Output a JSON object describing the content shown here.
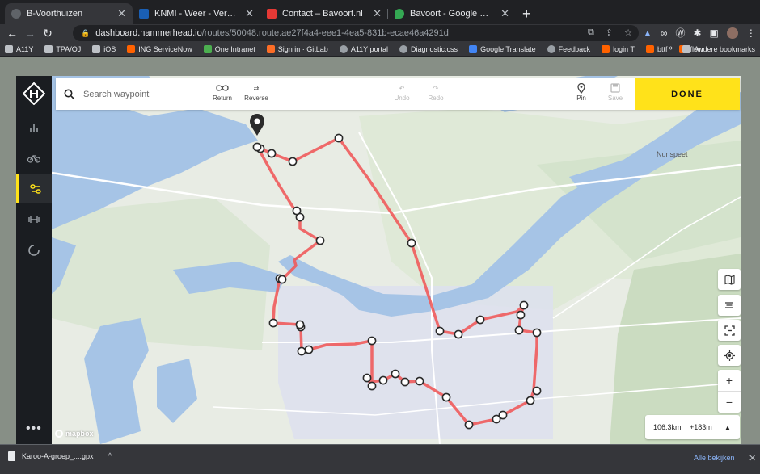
{
  "browser": {
    "tabs": [
      {
        "title": "B-Voorthuizen",
        "active": true,
        "favicon_color": "#5f6368"
      },
      {
        "title": "KNMI - Weer - Verwachtingen",
        "active": false,
        "favicon_color": "#1a5fb4"
      },
      {
        "title": "Contact – Bavoort.nl",
        "active": false,
        "favicon_color": "#e53935"
      },
      {
        "title": "Bavoort - Google Maps",
        "active": false,
        "favicon_color": "#34a853"
      }
    ],
    "url_host": "dashboard.hammerhead.io",
    "url_path": "/routes/50048.route.ae27f4a4-eee1-4ea5-831b-ecae46a4291d",
    "bookmarks": [
      {
        "label": "A11Y",
        "icon": "folder-icon",
        "color": "#bdc1c6"
      },
      {
        "label": "TPA/OJ",
        "icon": "folder-icon",
        "color": "#bdc1c6"
      },
      {
        "label": "iOS",
        "icon": "folder-icon",
        "color": "#bdc1c6"
      },
      {
        "label": "ING ServiceNow",
        "icon": "ing-icon",
        "color": "#ff6200"
      },
      {
        "label": "One Intranet",
        "icon": "microsoft-icon",
        "color": "#4caf50"
      },
      {
        "label": "Sign in · GitLab",
        "icon": "gitlab-icon",
        "color": "#fc6d26"
      },
      {
        "label": "A11Y portal",
        "icon": "globe-icon",
        "color": "#9aa0a6"
      },
      {
        "label": "Diagnostic.css",
        "icon": "globe-icon",
        "color": "#9aa0a6"
      },
      {
        "label": "Google Translate",
        "icon": "translate-icon",
        "color": "#4285f4"
      },
      {
        "label": "Feedback",
        "icon": "globe-icon",
        "color": "#9aa0a6"
      },
      {
        "label": "login T",
        "icon": "ing-icon",
        "color": "#ff6200"
      },
      {
        "label": "bttf",
        "icon": "ing-icon",
        "color": "#ff6200"
      },
      {
        "label": "flow",
        "icon": "ing-icon",
        "color": "#ff6200"
      }
    ],
    "bookmarks_more": "»",
    "other_bookmarks": "Andere bookmarks"
  },
  "app": {
    "search_placeholder": "Search waypoint",
    "tools": {
      "return": "Return",
      "reverse": "Reverse",
      "undo": "Undo",
      "redo": "Redo",
      "pin": "Pin",
      "save": "Save"
    },
    "done": "DONE",
    "accent": "#ffe21a",
    "route_color": "#ef5b5b"
  },
  "map": {
    "place_label": "Nunspeet",
    "attribution": "mapbox"
  },
  "stats": {
    "distance": "106.3km",
    "elevation": "+183m"
  },
  "downloads": {
    "file": "Karoo-A-groep_....gpx",
    "show_all": "Alle bekijken"
  }
}
